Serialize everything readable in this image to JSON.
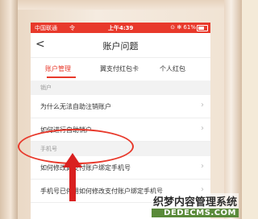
{
  "statusbar": {
    "carrier": "中国联通",
    "wifi": "令",
    "time": "上午4:39",
    "right": "⊙ ✻ 61%"
  },
  "navbar": {
    "back": "<",
    "title": "账户问题"
  },
  "tabs": [
    {
      "label": "账户管理",
      "active": true
    },
    {
      "label": "翼支付红包卡",
      "active": false
    },
    {
      "label": "个人红包",
      "active": false
    }
  ],
  "section_cancel": "销户",
  "items_cancel": [
    {
      "label": "为什么无法自助注销账户"
    },
    {
      "label": "如何进行自助销户"
    }
  ],
  "section_phone": "手机号",
  "items_phone": [
    {
      "label": "如何修改翼支付账户绑定手机号"
    },
    {
      "label": "手机号已停用如何修改支付账户绑定手机号"
    }
  ],
  "watermark": {
    "line1": "织梦内容管理系统",
    "line2": "DEDECMS.COM"
  },
  "colors": {
    "accent": "#e8392b",
    "arrow": "#d92020"
  }
}
